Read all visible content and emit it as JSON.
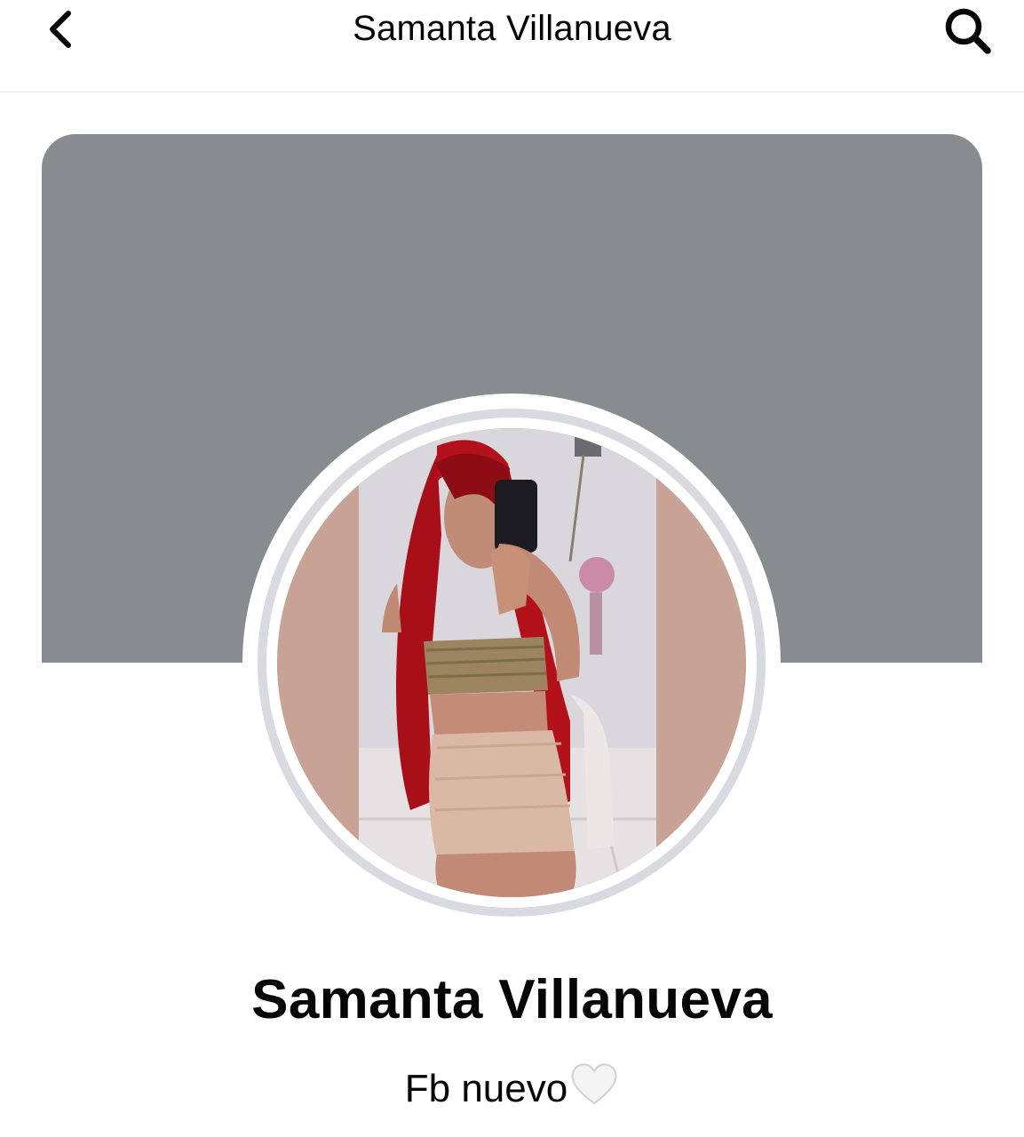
{
  "header": {
    "title": "Samanta Villanueva",
    "back_icon": "chevron-left-icon",
    "search_icon": "search-icon"
  },
  "cover": {
    "color": "#878c8f"
  },
  "profile": {
    "name": "Samanta Villanueva",
    "bio_text": "Fb nuevo",
    "bio_emoji": "white-heart-icon",
    "avatar_description_icon": "profile-photo"
  },
  "colors": {
    "text": "#050505",
    "divider": "#e4e6eb",
    "avatar_border": "#d9dadf"
  }
}
